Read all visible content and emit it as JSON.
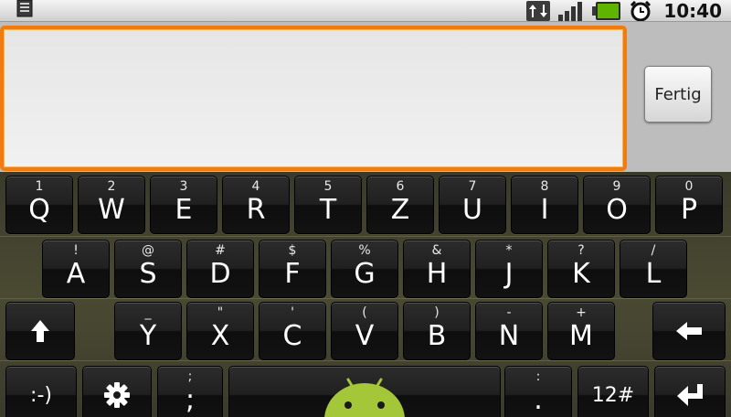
{
  "status_bar": {
    "time": "10:40",
    "icons": [
      "notification-icon",
      "data-transfer-icon",
      "signal-bars-icon",
      "battery-icon",
      "alarm-clock-icon"
    ],
    "battery_color": "#5fb400"
  },
  "edit": {
    "text": "",
    "done_label": "Fertig",
    "accent_color": "#f07c10"
  },
  "keyboard": {
    "row1": [
      {
        "main": "Q",
        "sub": "1"
      },
      {
        "main": "W",
        "sub": "2"
      },
      {
        "main": "E",
        "sub": "3"
      },
      {
        "main": "R",
        "sub": "4"
      },
      {
        "main": "T",
        "sub": "5"
      },
      {
        "main": "Z",
        "sub": "6"
      },
      {
        "main": "U",
        "sub": "7"
      },
      {
        "main": "I",
        "sub": "8"
      },
      {
        "main": "O",
        "sub": "9"
      },
      {
        "main": "P",
        "sub": "0"
      }
    ],
    "row2": [
      {
        "main": "A",
        "sub": "!"
      },
      {
        "main": "S",
        "sub": "@"
      },
      {
        "main": "D",
        "sub": "#"
      },
      {
        "main": "F",
        "sub": "$"
      },
      {
        "main": "G",
        "sub": "%"
      },
      {
        "main": "H",
        "sub": "&"
      },
      {
        "main": "J",
        "sub": "*"
      },
      {
        "main": "K",
        "sub": "?"
      },
      {
        "main": "L",
        "sub": "/"
      }
    ],
    "row3": [
      {
        "main": "Y",
        "sub": "_"
      },
      {
        "main": "X",
        "sub": "\""
      },
      {
        "main": "C",
        "sub": "'"
      },
      {
        "main": "V",
        "sub": "("
      },
      {
        "main": "B",
        "sub": ")"
      },
      {
        "main": "N",
        "sub": "-"
      },
      {
        "main": "M",
        "sub": "+"
      }
    ],
    "row4": {
      "smiley": ":-)",
      "semicolon_sub": ";",
      "semicolon_main": ";",
      "colon_sub": ":",
      "colon_main": ".",
      "symbols": "12#"
    },
    "icons": {
      "shift": "shift-arrow-icon",
      "delete": "backspace-arrow-icon",
      "settings": "gear-icon",
      "space": "android-robot-icon",
      "enter": "enter-arrow-icon"
    }
  }
}
